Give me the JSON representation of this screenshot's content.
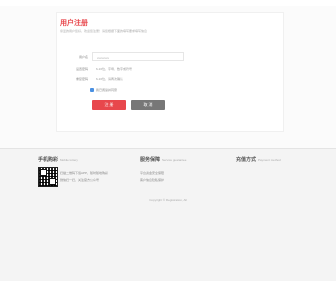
{
  "header": {
    "title": "用户注册",
    "subtitle": "亲爱的用户您好，欢迎您注册！请您根据下面的填写要求填写信息"
  },
  "form": {
    "fields": [
      {
        "label": "用户名",
        "value": "xxxxxxxx",
        "type": "input"
      },
      {
        "label": "设置密码",
        "value": "6-16位，字母、数字或符号",
        "type": "hint"
      },
      {
        "label": "重复密码",
        "value": "6-16位，请再次确认",
        "type": "hint"
      }
    ],
    "agree": "我已阅读并同意",
    "submit": "注 册",
    "cancel": "取 消"
  },
  "footer": {
    "mobile_title": "手机购彩",
    "mobile_sub": "Mobile lottery",
    "mobile_line1": "扫描二维码下载APP，随时随地购彩",
    "mobile_line2": "微信扫一扫，关注官方公众号",
    "service_title": "服务保障",
    "service_sub": "Service guarantee",
    "service_line1": "平台资金安全保障",
    "service_line2": "客户信息隐私保护",
    "pay_title": "充值方式",
    "pay_sub": "Payment method",
    "copyright": "Copyright © Registration, All"
  },
  "colors": {
    "accent": "#e8474c",
    "cancel": "#777777",
    "checkbox": "#4a90e2"
  }
}
